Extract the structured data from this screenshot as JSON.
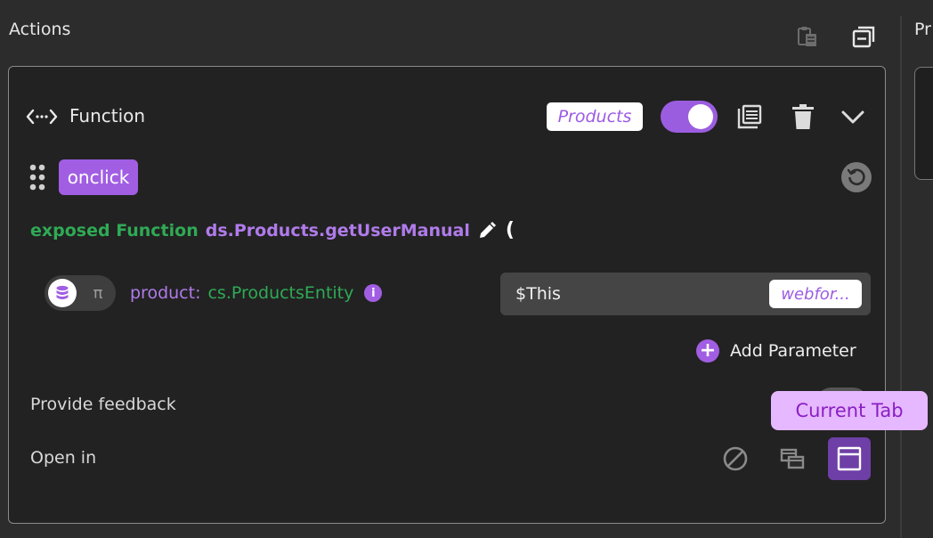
{
  "header": {
    "title": "Actions",
    "right_panel_label": "Pr",
    "icons": [
      "paste-icon",
      "collapse-all-icon"
    ]
  },
  "action": {
    "type_label": "Function",
    "datasource_badge": "Products",
    "enabled": true,
    "event_tag": "onclick",
    "signature": {
      "exposed_label": "exposed Function",
      "method": "ds.Products.getUserManual",
      "open_paren": "("
    },
    "parameter": {
      "name": "product:",
      "type": "cs.ProductsEntity",
      "value": "$This",
      "source": "webfor...",
      "mode_alt_symbol": "π"
    },
    "add_parameter_label": "Add Parameter",
    "provide_feedback_label": "Provide feedback",
    "open_in_label": "Open in",
    "open_in_tooltip": "Current Tab",
    "open_in_selected": "current-tab"
  },
  "colors": {
    "accent": "#a15ee3",
    "green": "#2faa55",
    "tooltip_bg": "#e6b8ff"
  }
}
